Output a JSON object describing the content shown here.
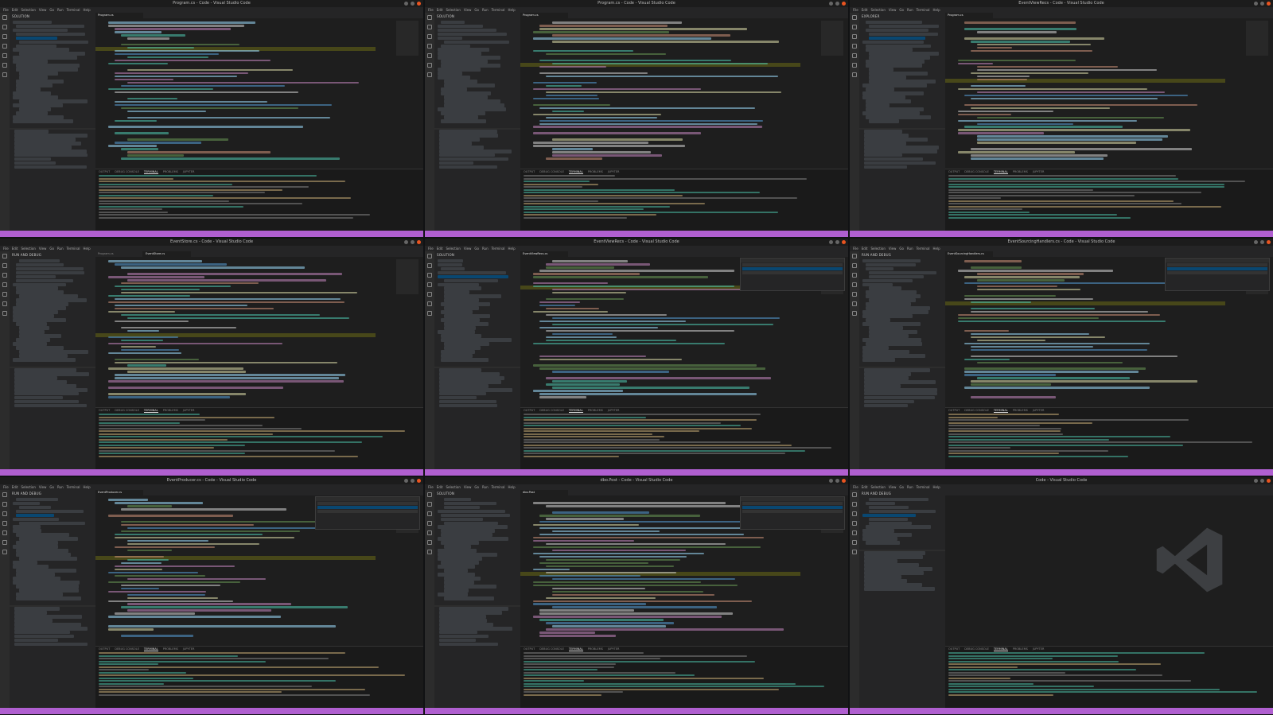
{
  "windows": [
    {
      "title": "Program.cs - Code - Visual Studio Code",
      "explorer": "SOLUTION",
      "tabs": [
        "Program.cs"
      ],
      "variant": "code"
    },
    {
      "title": "Program.cs - Code - Visual Studio Code",
      "explorer": "SOLUTION",
      "tabs": [
        "Program.cs"
      ],
      "variant": "code"
    },
    {
      "title": "EventViewRecs - Code - Visual Studio Code",
      "explorer": "EXPLORER",
      "tabs": [
        "Program.cs"
      ],
      "variant": "code"
    },
    {
      "title": "EventStore.cs - Code - Visual Studio Code",
      "explorer": "RUN AND DEBUG",
      "tabs": [
        "Program.cs",
        "EventStore.cs"
      ],
      "variant": "debug"
    },
    {
      "title": "EventViewRecs - Code - Visual Studio Code",
      "explorer": "SOLUTION",
      "tabs": [
        "EventViewRecs.cs"
      ],
      "variant": "result"
    },
    {
      "title": "EventSourcingHandlers.cs - Code - Visual Studio Code",
      "explorer": "RUN AND DEBUG",
      "tabs": [
        "EventSourcingHandlers.cs"
      ],
      "variant": "result"
    },
    {
      "title": "EventProducer.cs - Code - Visual Studio Code",
      "explorer": "RUN AND DEBUG",
      "tabs": [
        "EventProducer.cs"
      ],
      "variant": "result"
    },
    {
      "title": "dbo.Post - Code - Visual Studio Code",
      "explorer": "SOLUTION",
      "tabs": [
        "dbo.Post"
      ],
      "variant": "result"
    },
    {
      "title": "Code - Visual Studio Code",
      "explorer": "RUN AND DEBUG",
      "tabs": [],
      "variant": "empty"
    }
  ],
  "menu": [
    "File",
    "Edit",
    "Selection",
    "View",
    "Go",
    "Run",
    "Terminal",
    "Help"
  ],
  "panel_tabs": [
    "OUTPUT",
    "DEBUG CONSOLE",
    "TERMINAL",
    "PROBLEMS",
    "JUPYTER"
  ],
  "colors": {
    "status_bar": "#b05fd0",
    "highlight": "#4b4b18",
    "selection": "#094771"
  },
  "icons": [
    "files-icon",
    "search-icon",
    "source-control-icon",
    "run-debug-icon",
    "extensions-icon",
    "account-icon",
    "gear-icon"
  ]
}
